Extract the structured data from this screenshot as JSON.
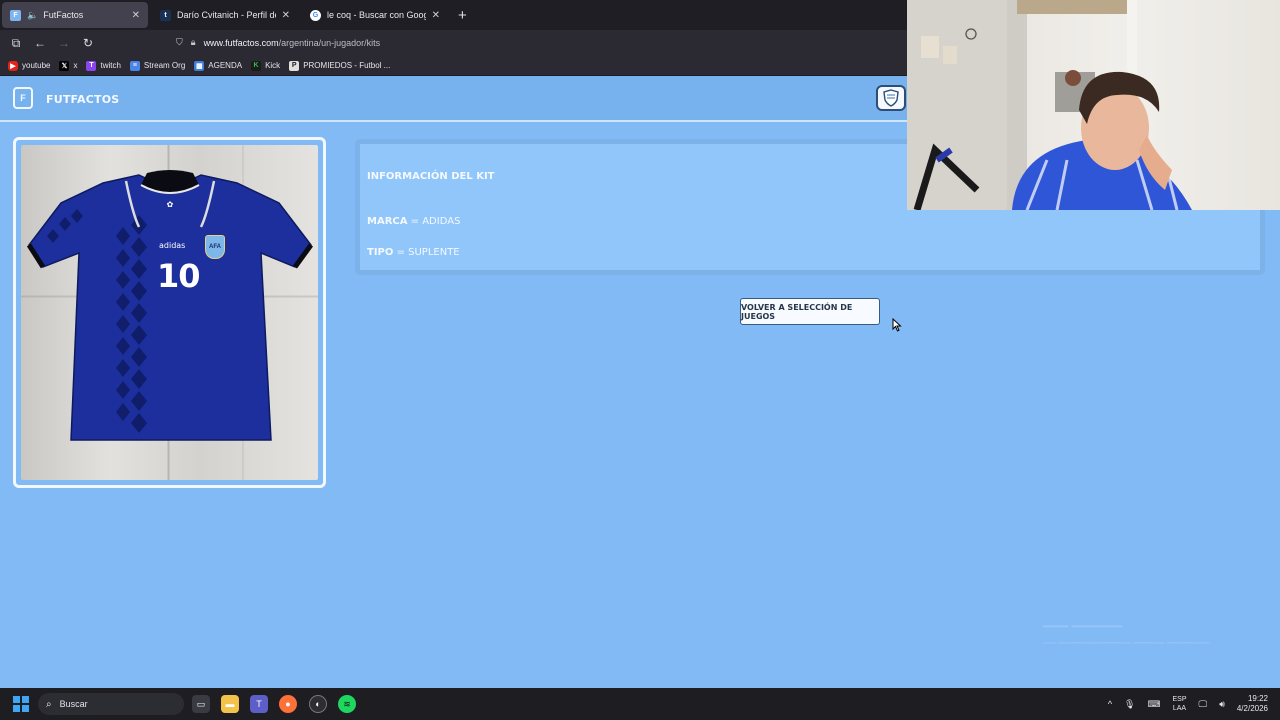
{
  "browser": {
    "tabs": [
      {
        "title": "FutFactos",
        "active": true,
        "favicon": "futfactos-icon",
        "favicon_color": "#7fb5ef",
        "audio": true
      },
      {
        "title": "Darío Cvitanich - Perfil del jugad",
        "active": false,
        "favicon": "transfermarkt-icon",
        "favicon_color": "#1a3151"
      },
      {
        "title": "le coq - Buscar con Google",
        "active": false,
        "favicon": "google-icon",
        "favicon_color": "#ffffff"
      }
    ],
    "url_host": "www.futfactos.com",
    "url_path": "/argentina/un-jugador/kits",
    "bookmarks": [
      {
        "label": "youtube",
        "icon": "youtube-icon",
        "color": "#e62117"
      },
      {
        "label": "x",
        "icon": "x-icon",
        "color": "#000000"
      },
      {
        "label": "twitch",
        "icon": "twitch-icon",
        "color": "#8a44f0"
      },
      {
        "label": "Stream Org",
        "icon": "docs-icon",
        "color": "#4a86e8"
      },
      {
        "label": "AGENDA",
        "icon": "calendar-icon",
        "color": "#3e7de0"
      },
      {
        "label": "Kick",
        "icon": "kick-icon",
        "color": "#26c24b"
      },
      {
        "label": "PROMIEDOS - Futbol ...",
        "icon": "promiedos-icon",
        "color": "#e0e0e0"
      }
    ]
  },
  "site": {
    "brand": "FUTFACTOS",
    "info_title": "INFORMACIÓN DEL KIT",
    "brand_label": "MARCA",
    "brand_value": "= ADIDAS",
    "type_label": "TIPO",
    "type_value": "= SUPLENTE",
    "back_button": "VOLVER A SELECCIÓN DE JUEGOS",
    "kit_number": "10",
    "kit_maker": "adidas",
    "kit_crest": "AFA",
    "colors": {
      "bg": "#82baf5",
      "panel": "#90c6fa",
      "kit": "#1c2f9c"
    }
  },
  "taskbar": {
    "search_placeholder": "Buscar",
    "lang_top": "ESP",
    "lang_bottom": "LAA",
    "time": "19:22",
    "date": "4/2/2026"
  }
}
